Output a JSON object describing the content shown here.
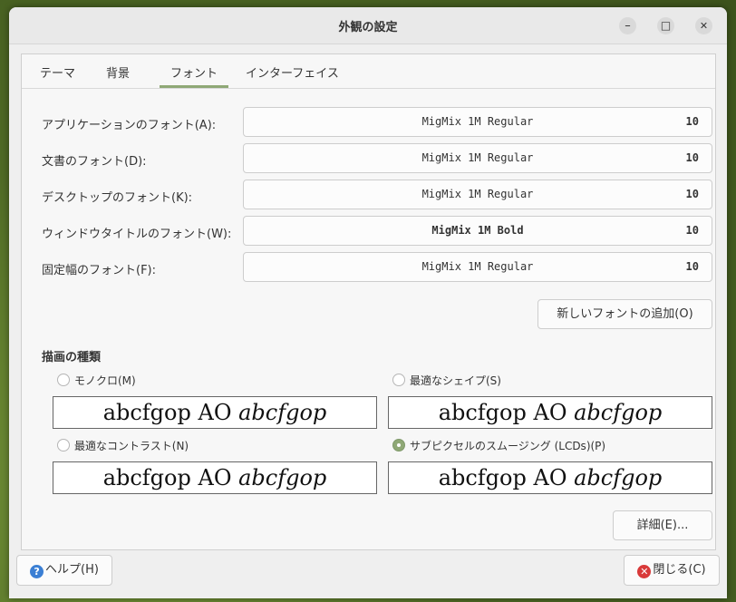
{
  "window": {
    "title": "外観の設定",
    "minimize_label": "–",
    "maximize_label": "□",
    "close_label": "✕"
  },
  "tabs": [
    {
      "label": "テーマ"
    },
    {
      "label": "背景"
    },
    {
      "label": "フォント",
      "active": true
    },
    {
      "label": "インターフェイス"
    }
  ],
  "fonts": [
    {
      "label": "アプリケーションのフォント(A):",
      "font": "MigMix 1M Regular",
      "size": "10"
    },
    {
      "label": "文書のフォント(D):",
      "font": "MigMix 1M Regular",
      "size": "10"
    },
    {
      "label": "デスクトップのフォント(K):",
      "font": "MigMix 1M Regular",
      "size": "10"
    },
    {
      "label": "ウィンドウタイトルのフォント(W):",
      "font": "MigMix 1M Bold",
      "size": "10"
    },
    {
      "label": "固定幅のフォント(F):",
      "font": "MigMix 1M Regular",
      "size": "10"
    }
  ],
  "add_font_label": "新しいフォントの追加(O)",
  "rendering": {
    "heading": "描画の種類",
    "options": [
      {
        "label": "モノクロ(M)",
        "selected": false,
        "sample_plain": "abcfgop AO ",
        "sample_italic": "abcfgop"
      },
      {
        "label": "最適なシェイプ(S)",
        "selected": false,
        "sample_plain": "abcfgop AO ",
        "sample_italic": "abcfgop"
      },
      {
        "label": "最適なコントラスト(N)",
        "selected": false,
        "sample_plain": "abcfgop AO ",
        "sample_italic": "abcfgop"
      },
      {
        "label": "サブピクセルのスムージング (LCDs)(P)",
        "selected": true,
        "sample_plain": "abcfgop AO ",
        "sample_italic": "abcfgop"
      }
    ]
  },
  "details_label": "詳細(E)...",
  "footer": {
    "help_label": "ヘルプ(H)",
    "close_label": "閉じる(C)"
  },
  "colors": {
    "accent": "#8fa876",
    "help_icon": "#3b7fd4",
    "close_icon": "#d93a3a"
  }
}
